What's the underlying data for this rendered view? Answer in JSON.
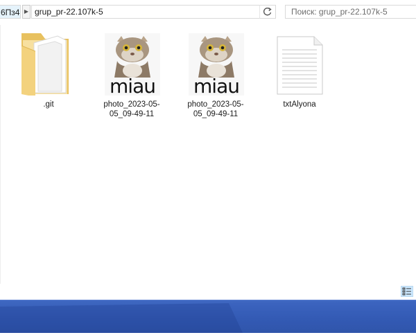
{
  "address_bar": {
    "prev_crumb": "6Пз4",
    "path": "grup_pr-22.107k-5",
    "separator_icon": "chevron-right-icon",
    "dropdown_icon": "chevron-down-icon",
    "refresh_icon": "refresh-icon",
    "search_placeholder": "Поиск: grup_pr-22.107k-5",
    "search_value": ""
  },
  "files": [
    {
      "name": ".git",
      "type": "folder",
      "icon": "folder-icon"
    },
    {
      "name": "photo_2023-05-05_09-49-11",
      "type": "image",
      "icon": "cat-photo-thumbnail",
      "thumb_caption": "miau"
    },
    {
      "name": "photo_2023-05-05_09-49-11",
      "type": "image",
      "icon": "cat-photo-thumbnail",
      "thumb_caption": "miau"
    },
    {
      "name": "txtAlyona",
      "type": "text",
      "icon": "text-file-icon"
    }
  ],
  "status_bar": {
    "view_icon": "details-view-icon"
  },
  "colors": {
    "taskbar": "#2f55ad",
    "selection_blue": "#cce8ff",
    "folder_yellow": "#f3d27e"
  }
}
